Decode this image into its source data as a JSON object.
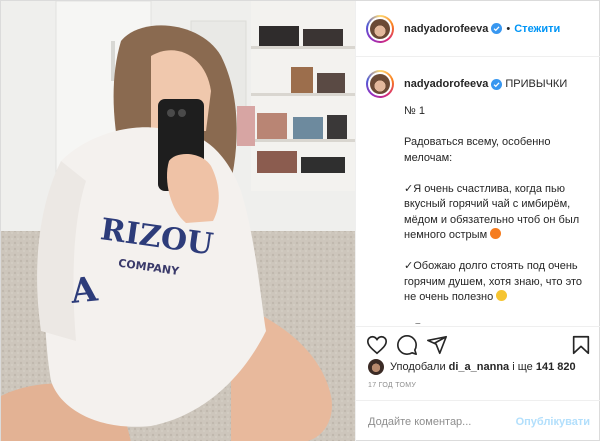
{
  "post": {
    "username": "nadyadorofeeva",
    "follow_label": "Стежити",
    "separator": "•"
  },
  "caption": {
    "title": "ПРИВЫЧКИ",
    "body": "№ 1\n\nРадоваться всему, особенно мелочам:\n\n✓Я очень счастлива, когда пью вкусный горячий чай с имбирём, мёдом и обязательно чтоб он был немного острым\n\n✓Обожаю долго стоять под очень горячим душем, хотя знаю, что это не очень полезно\n\n✓Я радуюсь всему, что имею, до сих пор не верю, что у меня есть своя машина и каждый раз садясь за",
    "emojis": [
      "fire",
      "grinning-face"
    ]
  },
  "likes": {
    "prefix": "Уподобали",
    "liker": "di_a_nanna",
    "separator": "і ще",
    "count": "141 820"
  },
  "timestamp": "17 ГОД ТОМУ",
  "comment": {
    "placeholder": "Додайте коментар...",
    "publish_label": "Опублікувати"
  },
  "icons": [
    "verified-badge-icon",
    "heart-icon",
    "comment-icon",
    "share-icon",
    "bookmark-icon"
  ],
  "colors": {
    "accent": "#0095f6",
    "publish_disabled": "#b2dffc",
    "muted": "#8e8e8e"
  }
}
